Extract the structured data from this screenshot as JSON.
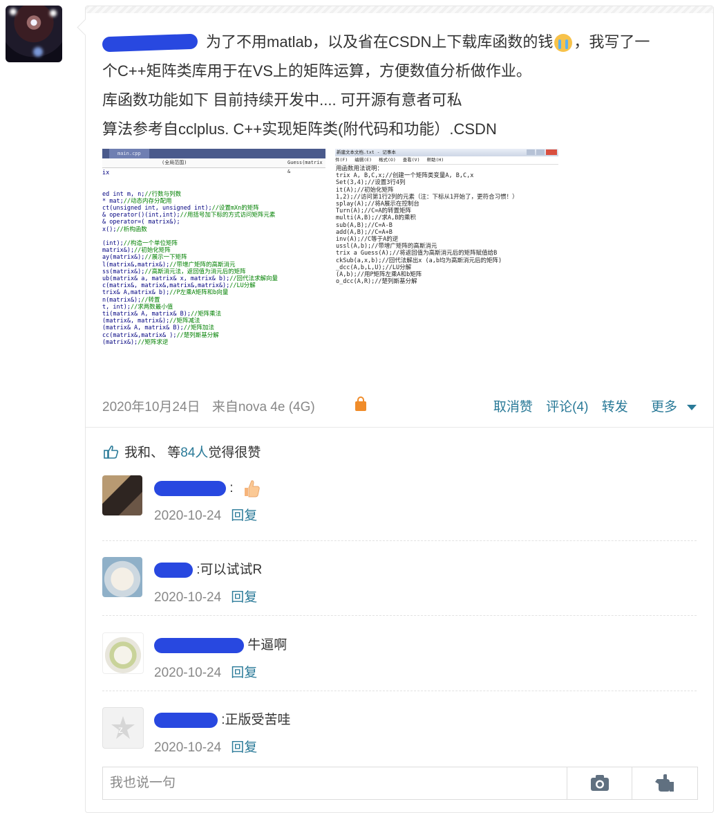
{
  "post": {
    "lines": [
      "为了不用matlab，以及省在CSDN上下载库函数的钱",
      "，我写了一",
      "个C++矩阵类库用于在VS上的矩阵运算，方便数值分析做作业。",
      "库函数功能如下 目前持续开发中.... 可开源有意者可私",
      "算法参考自cclplus. C++实现矩阵类(附代码和功能）.CSDN"
    ],
    "date": "2020年10月24日",
    "source": "来自nova 4e (4G)",
    "actions": {
      "unlike": "取消赞",
      "comment": "评论(4)",
      "repost": "转发",
      "more": "更多"
    }
  },
  "screenshot_vs": {
    "tab": "main.cpp",
    "dropdown1": "ix",
    "dropdown2": "(全局范围)",
    "dropdown3": "Guess(matrix &",
    "lines": [
      {
        "code": "ed int m, n;",
        "comment": "//行数与列数"
      },
      {
        "code": "* mat;",
        "comment": "//动态内存分配用"
      },
      {
        "code": "ct(unsigned int, unsigned int);",
        "comment": "//设置mXn的矩阵"
      },
      {
        "code": "& operator()(int,int);",
        "comment": "//用括号加下标的方式访问矩阵元素"
      },
      {
        "code": "& operator=( matrix&);",
        "comment": ""
      },
      {
        "code": "x();",
        "comment": "//析构函数"
      },
      {
        "code": "",
        "comment": ""
      },
      {
        "code": "(int);",
        "comment": "//构造一个单位矩阵"
      },
      {
        "code": "matrix&);",
        "comment": "//初始化矩阵"
      },
      {
        "code": "ay(matrix&);",
        "comment": "//展示一下矩阵"
      },
      {
        "code": "l(matrix&,matrix&);",
        "comment": "//带增广矩阵的高斯消元"
      },
      {
        "code": "ss(matrix&);",
        "comment": "//高斯消元法，返回值为消元后的矩阵"
      },
      {
        "code": "ub(matrix& a, matrix& x, matrix& b);",
        "comment": "//回代法求解向量"
      },
      {
        "code": "c(matrix&, matrix&,matrix&,matrix&);",
        "comment": "//LU分解"
      },
      {
        "code": "trix& A,matrix& b);",
        "comment": "//P左乘A矩阵和b向量"
      },
      {
        "code": "n(matrix&);",
        "comment": "//转置"
      },
      {
        "code": "t, int);",
        "comment": "//求两数最小值"
      },
      {
        "code": "ti(matrix& A, matrix& B);",
        "comment": "//矩阵乘法"
      },
      {
        "code": "(matrix&, matrix&);",
        "comment": "//矩阵减法"
      },
      {
        "code": "(matrix& A, matrix& B);",
        "comment": "//矩阵加法"
      },
      {
        "code": "cc(matrix&,matrix& );",
        "comment": "//楚列斯基分解"
      },
      {
        "code": "(matrix&);",
        "comment": "//矩阵求逆"
      }
    ]
  },
  "screenshot_notepad": {
    "title": "新建文本文档.txt - 记事本",
    "menu": [
      "件(F)",
      "编辑(E)",
      "格式(O)",
      "查看(V)",
      "帮助(H)"
    ],
    "lines": [
      "用函数用法说明：",
      "trix A, B,C,x;//创建一个矩阵类变量A, B,C,x",
      "Set(3,4);//设置3行4列",
      "it(A);//初始化矩阵",
      "1,2);//访问第1行2列的元素（注：下标从1开始了，更符合习惯！）",
      "splay(A);//将A展示在控制台",
      "Turn(A);//C=A的转置矩阵",
      "multi(A,B);//求A,B的乘积",
      "sub(A,B);//C=A-B",
      "add(A,B);//C=A+B",
      "inv(A);//C等于A的逆",
      "ussl(A,b);//带增广矩阵的高斯消元",
      "trix a Guess(A);//将返回值为高斯消元后的矩阵赋值给B",
      "ckSub(a,x,b);//回代法解出x (a,b均为高斯消元后的矩阵)",
      "_dcc(A,b,L,U);//LU分解",
      "(A,b);//用P矩阵左乘A和b矩阵",
      "o_dcc(A,R);//楚列斯基分解"
    ]
  },
  "likes": {
    "prefix": "我和、 等",
    "count": "84人",
    "suffix": "觉得很赞"
  },
  "comments": [
    {
      "text": ":",
      "date": "2020-10-24",
      "reply": "回复"
    },
    {
      "text": ":可以试试R",
      "date": "2020-10-24",
      "reply": "回复"
    },
    {
      "text": "牛逼啊",
      "date": "2020-10-24",
      "reply": "回复"
    },
    {
      "text": ":正版受苦哇",
      "date": "2020-10-24",
      "reply": "回复"
    }
  ],
  "input": {
    "placeholder": "我也说一句"
  },
  "colors": {
    "accent": "#2a7a98",
    "lock": "#f08c2a",
    "redaction": "#2848e0"
  },
  "icons": [
    "lock-icon",
    "thumbs-up-icon",
    "caret-down-icon",
    "camera-icon",
    "sticker-icon"
  ]
}
